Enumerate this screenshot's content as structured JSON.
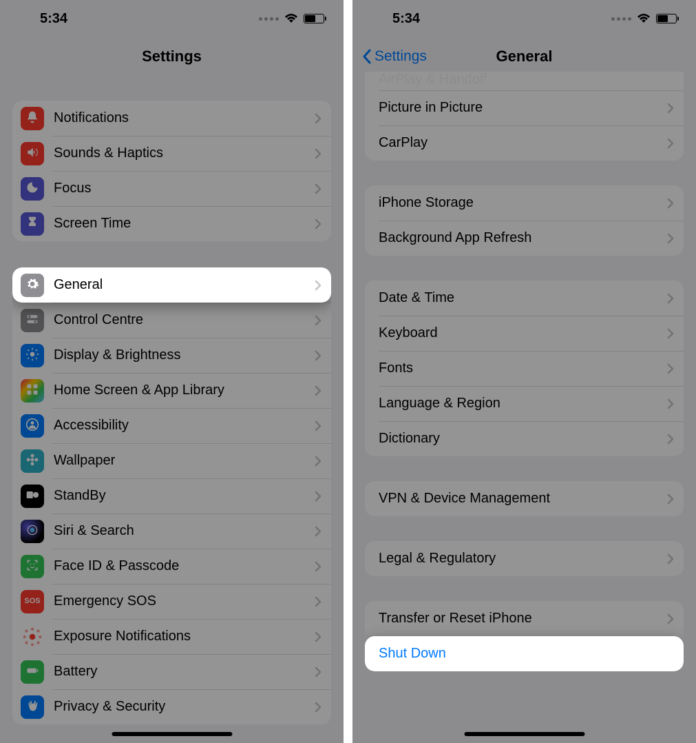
{
  "status": {
    "time": "5:34"
  },
  "left": {
    "title": "Settings",
    "group1": [
      {
        "label": "Notifications",
        "icon": "bell-icon",
        "color": "ic-red"
      },
      {
        "label": "Sounds & Haptics",
        "icon": "speaker-icon",
        "color": "ic-red"
      },
      {
        "label": "Focus",
        "icon": "moon-icon",
        "color": "ic-purple"
      },
      {
        "label": "Screen Time",
        "icon": "hourglass-icon",
        "color": "ic-purple"
      }
    ],
    "group2": [
      {
        "label": "General",
        "icon": "gear-icon",
        "color": "ic-gray",
        "highlight": true
      },
      {
        "label": "Control Centre",
        "icon": "switches-icon",
        "color": "ic-gray"
      },
      {
        "label": "Display & Brightness",
        "icon": "sun-icon",
        "color": "ic-blue"
      },
      {
        "label": "Home Screen & App Library",
        "icon": "grid-icon",
        "color": "ic-multi"
      },
      {
        "label": "Accessibility",
        "icon": "person-icon",
        "color": "ic-blue"
      },
      {
        "label": "Wallpaper",
        "icon": "flower-icon",
        "color": "ic-teal"
      },
      {
        "label": "StandBy",
        "icon": "clock-icon",
        "color": "ic-black"
      },
      {
        "label": "Siri & Search",
        "icon": "siri-icon",
        "color": "ic-siri"
      },
      {
        "label": "Face ID & Passcode",
        "icon": "faceid-icon",
        "color": "ic-green"
      },
      {
        "label": "Emergency SOS",
        "icon": "sos-icon",
        "color": "ic-red",
        "text_glyph": "SOS"
      },
      {
        "label": "Exposure Notifications",
        "icon": "exposure-icon",
        "color": "",
        "red_dots": true
      },
      {
        "label": "Battery",
        "icon": "battery-icon",
        "color": "ic-green"
      },
      {
        "label": "Privacy & Security",
        "icon": "hand-icon",
        "color": "ic-blue"
      }
    ]
  },
  "right": {
    "back": "Settings",
    "title": "General",
    "group_top_partial": "AirPlay & Handoff",
    "group0": [
      {
        "label": "Picture in Picture"
      },
      {
        "label": "CarPlay"
      }
    ],
    "group1": [
      {
        "label": "iPhone Storage"
      },
      {
        "label": "Background App Refresh"
      }
    ],
    "group2": [
      {
        "label": "Date & Time"
      },
      {
        "label": "Keyboard"
      },
      {
        "label": "Fonts"
      },
      {
        "label": "Language & Region"
      },
      {
        "label": "Dictionary"
      }
    ],
    "group3": [
      {
        "label": "VPN & Device Management"
      }
    ],
    "group4": [
      {
        "label": "Legal & Regulatory"
      }
    ],
    "group5": [
      {
        "label": "Transfer or Reset iPhone"
      },
      {
        "label": "Shut Down",
        "blue": true,
        "no_chev": true,
        "highlight": true
      }
    ]
  }
}
